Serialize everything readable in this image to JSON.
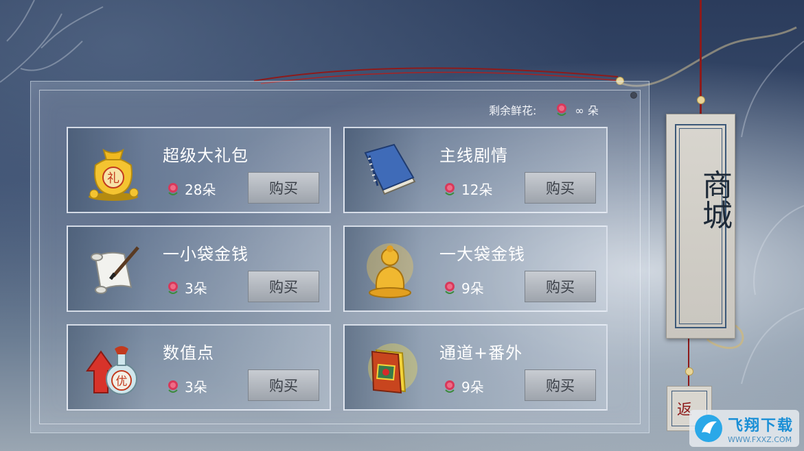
{
  "shop": {
    "title": "商城",
    "back_label": "返",
    "remaining_label": "剩余鲜花:",
    "remaining_value": "∞ 朵"
  },
  "items": [
    {
      "name": "超级大礼包",
      "price": "28朵",
      "buy_label": "购买",
      "icon": "gift-bag-icon"
    },
    {
      "name": "主线剧情",
      "price": "12朵",
      "buy_label": "购买",
      "icon": "book-icon"
    },
    {
      "name": "一小袋金钱",
      "price": "3朵",
      "buy_label": "购买",
      "icon": "scroll-icon"
    },
    {
      "name": "一大袋金钱",
      "price": "9朵",
      "buy_label": "购买",
      "icon": "buddha-icon"
    },
    {
      "name": "数值点",
      "price": "3朵",
      "buy_label": "购买",
      "icon": "potion-icon"
    },
    {
      "name": "通道+番外",
      "price": "9朵",
      "buy_label": "购买",
      "icon": "red-book-icon"
    }
  ],
  "watermark": {
    "title": "飞翔下载",
    "url": "WWW.FXXZ.COM"
  },
  "colors": {
    "rose": "#d8385a",
    "string": "#8e1a1a",
    "accent_blue": "#3b5878"
  }
}
